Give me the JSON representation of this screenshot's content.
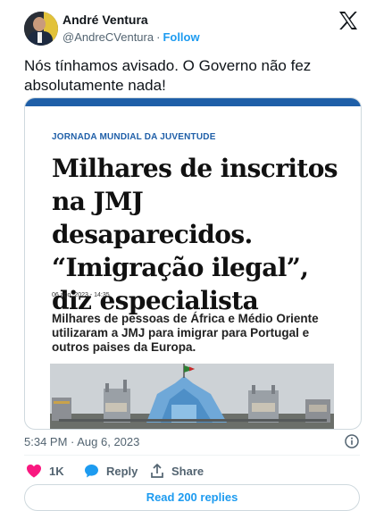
{
  "author": {
    "name": "André Ventura",
    "handle": "@AndreCVentura",
    "separator": "·",
    "follow_label": "Follow"
  },
  "tweet": {
    "text": "Nós tínhamos avisado. O Governo não fez absolutamente nada!",
    "timestamp": "5:34 PM · Aug 6, 2023"
  },
  "article": {
    "kicker": "JORNADA MUNDIAL DA JUVENTUDE",
    "headline": "Milhares de inscritos na JMJ desaparecidos. “Imigração ilegal”, diz especialista",
    "date": "06 ago, 2023 - 14:35",
    "summary": "Milhares de pessoas de África e Médio Oriente utilizaram a JMJ para imigrar para Portugal e outros paises da Europa.",
    "accent_color": "#1f5fa8"
  },
  "actions": {
    "like_count": "1K",
    "reply_label": "Reply",
    "share_label": "Share",
    "read_replies_label": "Read 200 replies"
  },
  "icons": {
    "like": "heart-icon",
    "reply": "speech-bubble-icon",
    "share": "share-icon",
    "info": "info-icon",
    "brand": "x-logo-icon"
  },
  "colors": {
    "like": "#f91880",
    "reply": "#1d9bf0",
    "link": "#1d9bf0",
    "muted": "#536471"
  }
}
